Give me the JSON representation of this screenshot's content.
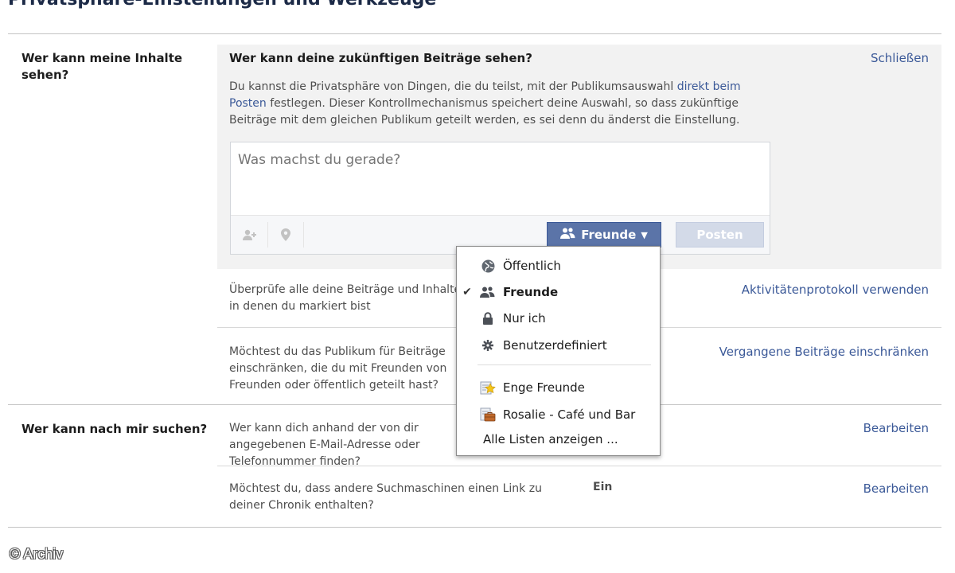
{
  "page": {
    "title": "Privatsphäre-Einstellungen und Werkzeuge"
  },
  "sections": {
    "content": {
      "label": "Wer kann meine Inhalte sehen?"
    },
    "search": {
      "label": "Wer kann nach mir suchen?"
    }
  },
  "panel": {
    "heading": "Wer kann deine zukünftigen Beiträge sehen?",
    "close_label": "Schließen",
    "desc_before": "Du kannst die Privatsphäre von Dingen, die du teilst, mit der Publikumsauswahl ",
    "desc_link": "direkt beim Posten",
    "desc_after": " festlegen. Dieser Kontrollmechanismus speichert deine Auswahl, so dass zukünftige Beiträge mit dem gleichen Publikum geteilt werden, es sei denn du änderst die Einstellung."
  },
  "composer": {
    "placeholder": "Was machst du gerade?",
    "audience_label": "Freunde",
    "post_label": "Posten",
    "tag_icon": "add-friend-icon",
    "location_icon": "location-pin-icon"
  },
  "rows": [
    {
      "text": "Überprüfe alle deine Beiträge und Inhalte, in denen du markiert bist",
      "action": "Aktivitätenprotokoll verwenden"
    },
    {
      "text": "Möchtest du das Publikum für Beiträge einschränken, die du mit Freunden von Freunden oder öffentlich geteilt hast?",
      "action": "Vergangene Beiträge einschränken"
    },
    {
      "text": "Wer kann dich anhand der von dir angegebenen E-Mail-Adresse oder Telefonnummer finden?",
      "action": "Bearbeiten"
    },
    {
      "text": "Möchtest du, dass andere Suchmaschinen einen Link zu deiner Chronik enthalten?",
      "value": "Ein",
      "action": "Bearbeiten"
    }
  ],
  "audience_menu": {
    "items": [
      {
        "label": "Öffentlich",
        "icon": "globe-icon",
        "selected": false
      },
      {
        "label": "Freunde",
        "icon": "friends-icon",
        "selected": true
      },
      {
        "label": "Nur ich",
        "icon": "lock-icon",
        "selected": false
      },
      {
        "label": "Benutzerdefiniert",
        "icon": "gear-icon",
        "selected": false
      }
    ],
    "lists": [
      {
        "label": "Enge Freunde",
        "icon": "star-list-icon"
      },
      {
        "label": "Rosalie - Café und Bar",
        "icon": "briefcase-list-icon"
      }
    ],
    "show_all": "Alle Listen anzeigen ...",
    "check_glyph": "✔"
  },
  "watermark": "© Archiv",
  "colors": {
    "link": "#3b5998",
    "audience_button": "#5b74a8",
    "panel_bg": "#f2f2f2"
  }
}
